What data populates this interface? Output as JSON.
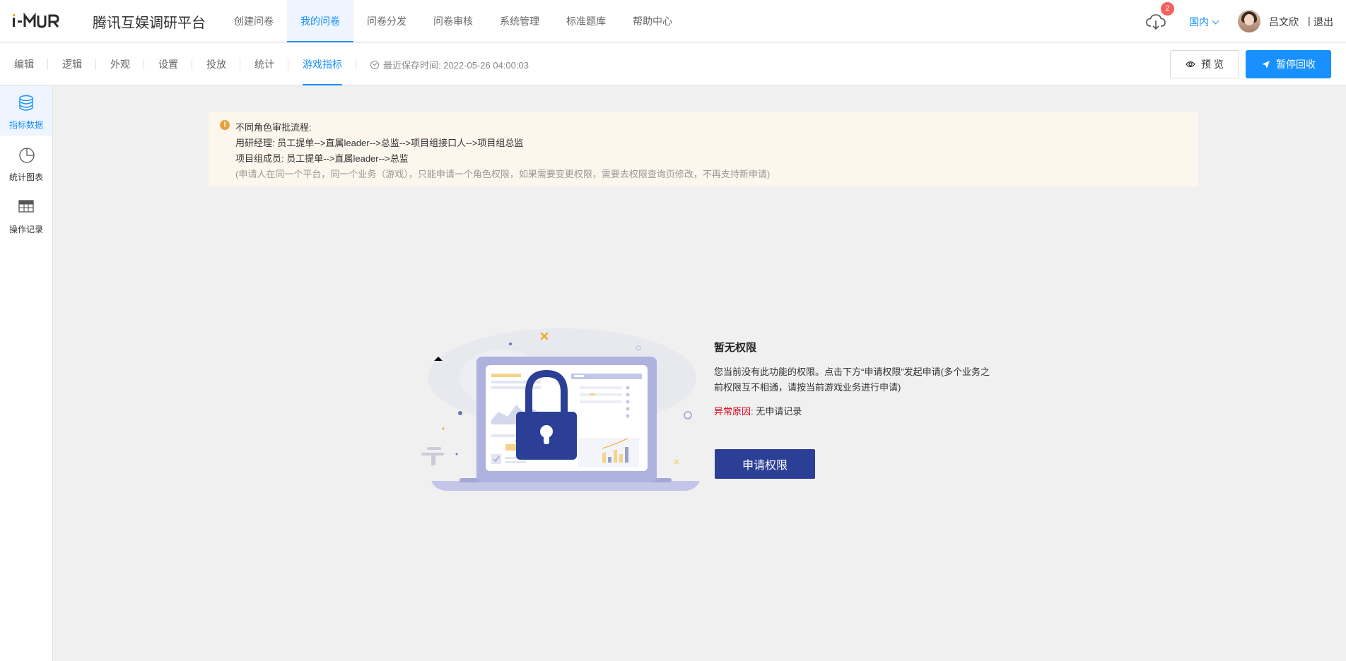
{
  "header": {
    "brand": "腾讯互娱调研平台",
    "nav": [
      "创建问卷",
      "我的问卷",
      "问卷分发",
      "问卷审核",
      "系统管理",
      "标准题库",
      "帮助中心"
    ],
    "active_nav": "我的问卷",
    "download_badge": "2",
    "region": "国内",
    "username": "吕文欣",
    "separator": "|",
    "logout": "退出"
  },
  "subheader": {
    "tabs": [
      "编辑",
      "逻辑",
      "外观",
      "设置",
      "投放",
      "统计",
      "游戏指标"
    ],
    "active_tab": "游戏指标",
    "saved_time": "最近保存时间: 2022-05-26 04:00:03",
    "preview_label": "预 览",
    "pause_label": "暂停回收"
  },
  "sidebar": {
    "items": [
      {
        "label": "指标数据",
        "icon": "database-icon",
        "active": true
      },
      {
        "label": "统计图表",
        "icon": "pie-chart-icon",
        "active": false
      },
      {
        "label": "操作记录",
        "icon": "table-icon",
        "active": false
      }
    ]
  },
  "notice": {
    "title": "不同角色审批流程:",
    "line1": "用研经理:  员工提单-->直属leader-->总监-->项目组接口人-->项目组总监",
    "line2": "项目组成员: 员工提单-->直属leader-->总监",
    "line3": "(申请人在同一个平台，同一个业务（游戏），只能申请一个角色权限，如果需要变更权限，需要去权限查询页修改，不再支持新申请)"
  },
  "permission": {
    "title": "暂无权限",
    "description": "您当前没有此功能的权限。点击下方“申请权限”发起申请(多个业务之前权限互不相通，请按当前游戏业务进行申请)",
    "reason_label": "异常原因:",
    "reason_value": "无申请记录",
    "apply_button": "申请权限"
  },
  "colors": {
    "primary": "#1890ff",
    "apply_button": "#2b3f96",
    "warning": "#e6a23c",
    "error": "#e0001b"
  }
}
